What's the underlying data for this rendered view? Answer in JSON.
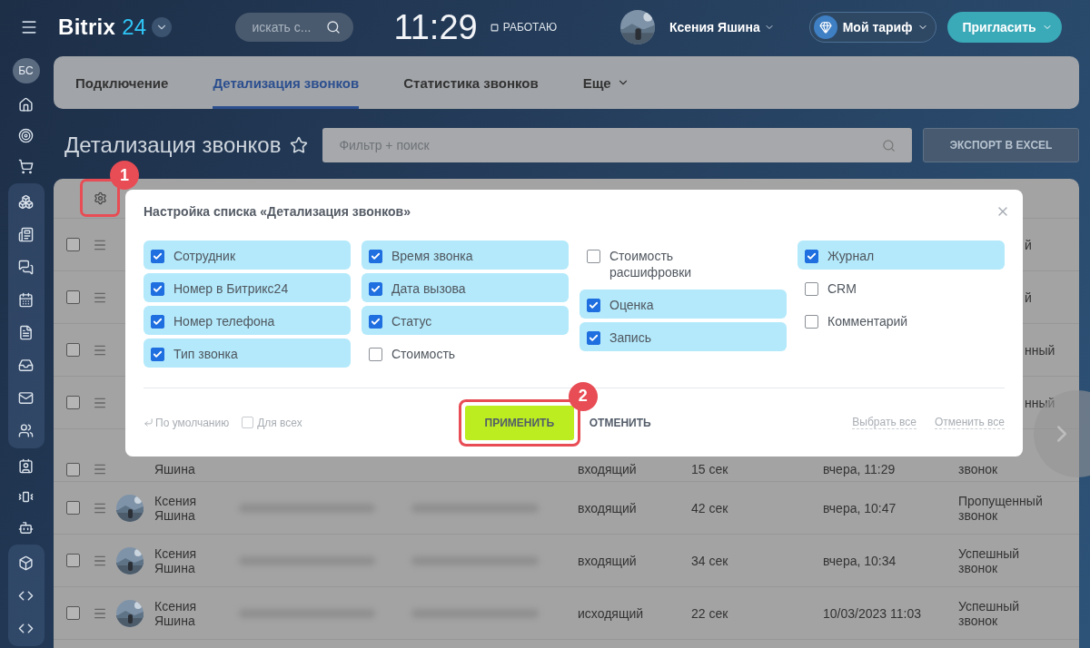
{
  "header": {
    "logo_text": "Bitrix",
    "logo_number": "24",
    "search_placeholder": "искать с...",
    "time": "11:29",
    "work_status": "РАБОТАЮ",
    "user_name": "Ксения Яшина",
    "tariff_button": "Мой тариф",
    "invite_button": "Пригласить"
  },
  "sidebar": {
    "avatar": "БС"
  },
  "tabs": [
    {
      "label": "Подключение",
      "selected": false,
      "has_menu": false
    },
    {
      "label": "Детализация звонков",
      "selected": true,
      "has_menu": false
    },
    {
      "label": "Статистика звонков",
      "selected": false,
      "has_menu": false
    },
    {
      "label": "Еще",
      "selected": false,
      "has_menu": true
    }
  ],
  "page_title": "Детализация звонков",
  "filter_placeholder": "Фильтр + поиск",
  "export_button": "ЭКСПОРТ В EXCEL",
  "table": {
    "rows": [
      {
        "kind": "covered",
        "checked": false,
        "status": "й"
      },
      {
        "kind": "covered",
        "checked": false,
        "status": "й"
      },
      {
        "kind": "covered",
        "checked": false,
        "status": "нный"
      },
      {
        "kind": "covered",
        "checked": false,
        "status": "нный"
      },
      {
        "kind": "partial",
        "checked": false,
        "name": "Яшина",
        "type": "входящий",
        "duration": "15 сек",
        "date": "вчера, 11:29",
        "status": "звонок"
      },
      {
        "kind": "full",
        "checked": false,
        "name": "Ксения Яшина",
        "type": "входящий",
        "duration": "42 сек",
        "date": "вчера, 10:47",
        "status": "Пропущенный звонок"
      },
      {
        "kind": "full",
        "checked": false,
        "name": "Ксения Яшина",
        "type": "входящий",
        "duration": "34 сек",
        "date": "вчера, 10:34",
        "status": "Успешный звонок"
      },
      {
        "kind": "full",
        "checked": false,
        "name": "Ксения Яшина",
        "type": "исходящий",
        "duration": "22 сек",
        "date": "10/03/2023 11:03",
        "status": "Успешный звонок"
      }
    ]
  },
  "modal": {
    "title": "Настройка списка «Детализация звонков»",
    "columns": [
      [
        {
          "label": "Сотрудник",
          "checked": true
        },
        {
          "label": "Номер в Битрикс24",
          "checked": true
        },
        {
          "label": "Номер телефона",
          "checked": true
        },
        {
          "label": "Тип звонка",
          "checked": true
        }
      ],
      [
        {
          "label": "Время звонка",
          "checked": true
        },
        {
          "label": "Дата вызова",
          "checked": true
        },
        {
          "label": "Статус",
          "checked": true
        },
        {
          "label": "Стоимость",
          "checked": false
        }
      ],
      [
        {
          "label": "Стоимость расшифровки",
          "checked": false
        },
        {
          "label": "Оценка",
          "checked": true
        },
        {
          "label": "Запись",
          "checked": true
        }
      ],
      [
        {
          "label": "Журнал",
          "checked": true
        },
        {
          "label": "CRM",
          "checked": false
        },
        {
          "label": "Комментарий",
          "checked": false
        }
      ]
    ],
    "default_link": "По умолчанию",
    "for_all": {
      "label": "Для всех",
      "checked": false
    },
    "apply_button": "ПРИМЕНИТЬ",
    "cancel_button": "ОТМЕНИТЬ",
    "select_all": "Выбрать все",
    "deselect_all": "Отменить все"
  },
  "callouts": [
    "1",
    "2"
  ]
}
